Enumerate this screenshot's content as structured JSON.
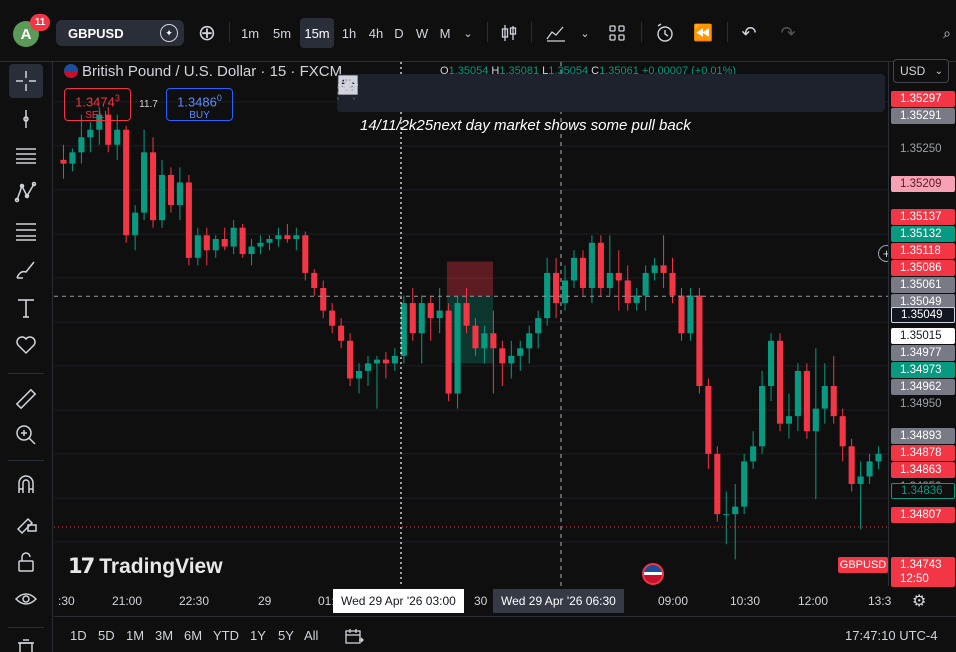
{
  "header": {
    "avatar_letter": "A",
    "notifications": "11",
    "symbol": "GBPUSD",
    "intervals": [
      "1m",
      "5m",
      "15m",
      "1h",
      "4h",
      "D",
      "W",
      "M"
    ],
    "active_interval": "15m"
  },
  "legend": {
    "title": "British Pound / U.S. Dollar · 15 · FXCM",
    "ohlc": {
      "o": "1.35054",
      "h": "1.35081",
      "l": "1.35054",
      "c": "1.35061",
      "change": "+0.00007 (+0.01%)"
    },
    "sell": {
      "price_main": "1.3474",
      "price_pip": "3",
      "label": "SELL"
    },
    "spread": "11.7",
    "buy": {
      "price_main": "1.3486",
      "price_pip": "0",
      "label": "BUY"
    }
  },
  "annotation": "14/11/2k25next day market shows some pull back",
  "watermark": "TradingView",
  "price_scale": {
    "currency": "USD",
    "labels": [
      {
        "text": "1.35297",
        "style": "tag",
        "color": "#f23645"
      },
      {
        "text": "1.35291",
        "style": "tag",
        "color": "#787b86"
      },
      {
        "text": "1.35250",
        "style": "plain"
      },
      {
        "text": "1.35209",
        "style": "tag",
        "color": "#f7a1b4"
      },
      {
        "text": "1.35137",
        "style": "tag",
        "color": "#f23645"
      },
      {
        "text": "1.35132",
        "style": "tag",
        "color": "#089981"
      },
      {
        "text": "1.35118",
        "style": "tag",
        "color": "#f23645"
      },
      {
        "text": "1.35086",
        "style": "tag",
        "color": "#f23645"
      },
      {
        "text": "1.35061",
        "style": "tag",
        "color": "#787b86"
      },
      {
        "text": "1.35049",
        "style": "tag",
        "color": "#787b86"
      },
      {
        "text": "1.35049",
        "style": "tag",
        "color": "#131722"
      },
      {
        "text": "1.35015",
        "style": "tag",
        "color": "#ffffff"
      },
      {
        "text": "1.34977",
        "style": "tag",
        "color": "#787b86"
      },
      {
        "text": "1.34973",
        "style": "tag",
        "color": "#089981"
      },
      {
        "text": "1.34962",
        "style": "tag",
        "color": "#787b86"
      },
      {
        "text": "1.34950",
        "style": "plain"
      },
      {
        "text": "1.34893",
        "style": "tag",
        "color": "#787b86"
      },
      {
        "text": "1.34878",
        "style": "tag",
        "color": "#f23645"
      },
      {
        "text": "1.34863",
        "style": "tag",
        "color": "#f23645"
      },
      {
        "text": "1.34850",
        "style": "plain"
      },
      {
        "text": "1.34836",
        "style": "tag",
        "color": "#0f0f0f"
      },
      {
        "text": "1.34807",
        "style": "tag",
        "color": "#f23645"
      },
      {
        "text": "1.34743",
        "style": "tag",
        "color": "#f23645"
      },
      {
        "text": "12:50",
        "style": "tag",
        "color": "#f23645"
      }
    ],
    "symbol_tag": "GBPUSD"
  },
  "time_axis": {
    "labels": [
      ":30",
      "21:00",
      "22:30",
      "29",
      "01:",
      "30",
      "09:00",
      "10:30",
      "12:00",
      "13:3"
    ],
    "crosshair_left": "Wed 29 Apr '26   03:00",
    "crosshair_right": "Wed 29 Apr '26   06:30"
  },
  "bottom": {
    "ranges": [
      "1D",
      "5D",
      "1M",
      "3M",
      "6M",
      "YTD",
      "1Y",
      "5Y",
      "All"
    ],
    "clock": "17:47:10 UTC-4"
  },
  "chart_data": {
    "type": "candlestick",
    "symbol": "GBPUSD",
    "interval": "15",
    "ylim": [
      1.3467,
      1.3532
    ],
    "candles": [
      {
        "o": 1.3523,
        "h": 1.3525,
        "l": 1.35205,
        "c": 1.35225
      },
      {
        "o": 1.35225,
        "h": 1.35245,
        "l": 1.35215,
        "c": 1.3524
      },
      {
        "o": 1.3524,
        "h": 1.3529,
        "l": 1.35225,
        "c": 1.3526
      },
      {
        "o": 1.3526,
        "h": 1.3528,
        "l": 1.3524,
        "c": 1.3527
      },
      {
        "o": 1.3527,
        "h": 1.353,
        "l": 1.3525,
        "c": 1.3529
      },
      {
        "o": 1.3529,
        "h": 1.353,
        "l": 1.3524,
        "c": 1.3525
      },
      {
        "o": 1.3525,
        "h": 1.3529,
        "l": 1.3523,
        "c": 1.3527
      },
      {
        "o": 1.3527,
        "h": 1.35275,
        "l": 1.3512,
        "c": 1.3513
      },
      {
        "o": 1.3513,
        "h": 1.3517,
        "l": 1.3511,
        "c": 1.3516
      },
      {
        "o": 1.3516,
        "h": 1.3527,
        "l": 1.3515,
        "c": 1.3524
      },
      {
        "o": 1.3524,
        "h": 1.3526,
        "l": 1.3514,
        "c": 1.3515
      },
      {
        "o": 1.3515,
        "h": 1.3523,
        "l": 1.3514,
        "c": 1.3521
      },
      {
        "o": 1.3521,
        "h": 1.3522,
        "l": 1.3516,
        "c": 1.3517
      },
      {
        "o": 1.3517,
        "h": 1.3522,
        "l": 1.3515,
        "c": 1.352
      },
      {
        "o": 1.352,
        "h": 1.3521,
        "l": 1.3509,
        "c": 1.351
      },
      {
        "o": 1.351,
        "h": 1.3514,
        "l": 1.3509,
        "c": 1.3513
      },
      {
        "o": 1.3513,
        "h": 1.3514,
        "l": 1.3509,
        "c": 1.3511
      },
      {
        "o": 1.3511,
        "h": 1.3513,
        "l": 1.351,
        "c": 1.35125
      },
      {
        "o": 1.35125,
        "h": 1.3514,
        "l": 1.3511,
        "c": 1.35115
      },
      {
        "o": 1.35115,
        "h": 1.3515,
        "l": 1.35105,
        "c": 1.3514
      },
      {
        "o": 1.3514,
        "h": 1.35145,
        "l": 1.351,
        "c": 1.35105
      },
      {
        "o": 1.35105,
        "h": 1.35125,
        "l": 1.3509,
        "c": 1.35115
      },
      {
        "o": 1.35115,
        "h": 1.3513,
        "l": 1.35105,
        "c": 1.3512
      },
      {
        "o": 1.3512,
        "h": 1.3513,
        "l": 1.3511,
        "c": 1.35125
      },
      {
        "o": 1.35125,
        "h": 1.3514,
        "l": 1.35115,
        "c": 1.3513
      },
      {
        "o": 1.3513,
        "h": 1.35145,
        "l": 1.3512,
        "c": 1.35125
      },
      {
        "o": 1.35125,
        "h": 1.3514,
        "l": 1.3511,
        "c": 1.3513
      },
      {
        "o": 1.3513,
        "h": 1.35135,
        "l": 1.3507,
        "c": 1.3508
      },
      {
        "o": 1.3508,
        "h": 1.35085,
        "l": 1.3505,
        "c": 1.3506
      },
      {
        "o": 1.3506,
        "h": 1.3507,
        "l": 1.3502,
        "c": 1.3503
      },
      {
        "o": 1.3503,
        "h": 1.3504,
        "l": 1.35,
        "c": 1.3501
      },
      {
        "o": 1.3501,
        "h": 1.3502,
        "l": 1.3498,
        "c": 1.3499
      },
      {
        "o": 1.3499,
        "h": 1.35,
        "l": 1.3493,
        "c": 1.3494
      },
      {
        "o": 1.3494,
        "h": 1.3496,
        "l": 1.3492,
        "c": 1.3495
      },
      {
        "o": 1.3495,
        "h": 1.3497,
        "l": 1.3493,
        "c": 1.3496
      },
      {
        "o": 1.3496,
        "h": 1.3497,
        "l": 1.349,
        "c": 1.34965
      },
      {
        "o": 1.34965,
        "h": 1.34975,
        "l": 1.3494,
        "c": 1.3496
      },
      {
        "o": 1.3496,
        "h": 1.3498,
        "l": 1.3495,
        "c": 1.3497
      },
      {
        "o": 1.3497,
        "h": 1.3505,
        "l": 1.3496,
        "c": 1.3504
      },
      {
        "o": 1.3504,
        "h": 1.3506,
        "l": 1.3499,
        "c": 1.35
      },
      {
        "o": 1.35,
        "h": 1.3505,
        "l": 1.3496,
        "c": 1.3504
      },
      {
        "o": 1.3504,
        "h": 1.3505,
        "l": 1.3499,
        "c": 1.3502
      },
      {
        "o": 1.3502,
        "h": 1.3506,
        "l": 1.35,
        "c": 1.3503
      },
      {
        "o": 1.3503,
        "h": 1.3504,
        "l": 1.3491,
        "c": 1.3492
      },
      {
        "o": 1.3492,
        "h": 1.3505,
        "l": 1.349,
        "c": 1.3504
      },
      {
        "o": 1.3504,
        "h": 1.3506,
        "l": 1.35,
        "c": 1.3501
      },
      {
        "o": 1.3501,
        "h": 1.3502,
        "l": 1.3497,
        "c": 1.3498
      },
      {
        "o": 1.3498,
        "h": 1.3501,
        "l": 1.3496,
        "c": 1.35
      },
      {
        "o": 1.35,
        "h": 1.3503,
        "l": 1.3492,
        "c": 1.3498
      },
      {
        "o": 1.3498,
        "h": 1.3499,
        "l": 1.3493,
        "c": 1.3496
      },
      {
        "o": 1.3496,
        "h": 1.3499,
        "l": 1.3494,
        "c": 1.3497
      },
      {
        "o": 1.3497,
        "h": 1.3499,
        "l": 1.3495,
        "c": 1.3498
      },
      {
        "o": 1.3498,
        "h": 1.3501,
        "l": 1.3496,
        "c": 1.35
      },
      {
        "o": 1.35,
        "h": 1.3503,
        "l": 1.3498,
        "c": 1.3502
      },
      {
        "o": 1.3502,
        "h": 1.351,
        "l": 1.3501,
        "c": 1.3508
      },
      {
        "o": 1.3508,
        "h": 1.351,
        "l": 1.3502,
        "c": 1.3504
      },
      {
        "o": 1.3504,
        "h": 1.3509,
        "l": 1.3503,
        "c": 1.3507
      },
      {
        "o": 1.3507,
        "h": 1.3511,
        "l": 1.3506,
        "c": 1.351
      },
      {
        "o": 1.351,
        "h": 1.3511,
        "l": 1.3505,
        "c": 1.3506
      },
      {
        "o": 1.3506,
        "h": 1.3513,
        "l": 1.3504,
        "c": 1.3512
      },
      {
        "o": 1.3512,
        "h": 1.3513,
        "l": 1.3505,
        "c": 1.3506
      },
      {
        "o": 1.3506,
        "h": 1.3513,
        "l": 1.3505,
        "c": 1.3508
      },
      {
        "o": 1.3508,
        "h": 1.3511,
        "l": 1.3503,
        "c": 1.3507
      },
      {
        "o": 1.3507,
        "h": 1.3509,
        "l": 1.3503,
        "c": 1.3504
      },
      {
        "o": 1.3504,
        "h": 1.3506,
        "l": 1.3503,
        "c": 1.3505
      },
      {
        "o": 1.3505,
        "h": 1.3509,
        "l": 1.3503,
        "c": 1.3508
      },
      {
        "o": 1.3508,
        "h": 1.351,
        "l": 1.3507,
        "c": 1.3509
      },
      {
        "o": 1.3509,
        "h": 1.3513,
        "l": 1.3506,
        "c": 1.3508
      },
      {
        "o": 1.3508,
        "h": 1.351,
        "l": 1.3504,
        "c": 1.3505
      },
      {
        "o": 1.3505,
        "h": 1.3506,
        "l": 1.3499,
        "c": 1.35
      },
      {
        "o": 1.35,
        "h": 1.3506,
        "l": 1.3499,
        "c": 1.3505
      },
      {
        "o": 1.3505,
        "h": 1.3506,
        "l": 1.3492,
        "c": 1.3493
      },
      {
        "o": 1.3493,
        "h": 1.3494,
        "l": 1.3482,
        "c": 1.3484
      },
      {
        "o": 1.3484,
        "h": 1.3485,
        "l": 1.3475,
        "c": 1.3476
      },
      {
        "o": 1.3476,
        "h": 1.3479,
        "l": 1.3472,
        "c": 1.3476
      },
      {
        "o": 1.3476,
        "h": 1.348,
        "l": 1.347,
        "c": 1.3477
      },
      {
        "o": 1.3477,
        "h": 1.3484,
        "l": 1.3476,
        "c": 1.3483
      },
      {
        "o": 1.3483,
        "h": 1.3487,
        "l": 1.3482,
        "c": 1.3485
      },
      {
        "o": 1.3485,
        "h": 1.3495,
        "l": 1.3484,
        "c": 1.3493
      },
      {
        "o": 1.3493,
        "h": 1.35,
        "l": 1.3491,
        "c": 1.3499
      },
      {
        "o": 1.3499,
        "h": 1.35,
        "l": 1.3487,
        "c": 1.3488
      },
      {
        "o": 1.3488,
        "h": 1.3492,
        "l": 1.3486,
        "c": 1.3489
      },
      {
        "o": 1.3489,
        "h": 1.3496,
        "l": 1.3487,
        "c": 1.3495
      },
      {
        "o": 1.3495,
        "h": 1.3496,
        "l": 1.3486,
        "c": 1.3487
      },
      {
        "o": 1.3487,
        "h": 1.3498,
        "l": 1.3478,
        "c": 1.349
      },
      {
        "o": 1.349,
        "h": 1.3496,
        "l": 1.3488,
        "c": 1.3493
      },
      {
        "o": 1.3493,
        "h": 1.3497,
        "l": 1.3488,
        "c": 1.3489
      },
      {
        "o": 1.3489,
        "h": 1.349,
        "l": 1.3483,
        "c": 1.3485
      },
      {
        "o": 1.3485,
        "h": 1.3486,
        "l": 1.3479,
        "c": 1.348
      },
      {
        "o": 1.348,
        "h": 1.3483,
        "l": 1.3474,
        "c": 1.3481
      },
      {
        "o": 1.3481,
        "h": 1.3484,
        "l": 1.348,
        "c": 1.3483
      },
      {
        "o": 1.3483,
        "h": 1.3485,
        "l": 1.3482,
        "c": 1.3484
      }
    ],
    "position_tool": {
      "entry": 1.35049,
      "stop": 1.35095,
      "target": 1.3496
    },
    "horizontal_line": 1.35049,
    "dotted_price_line": 1.34743
  }
}
